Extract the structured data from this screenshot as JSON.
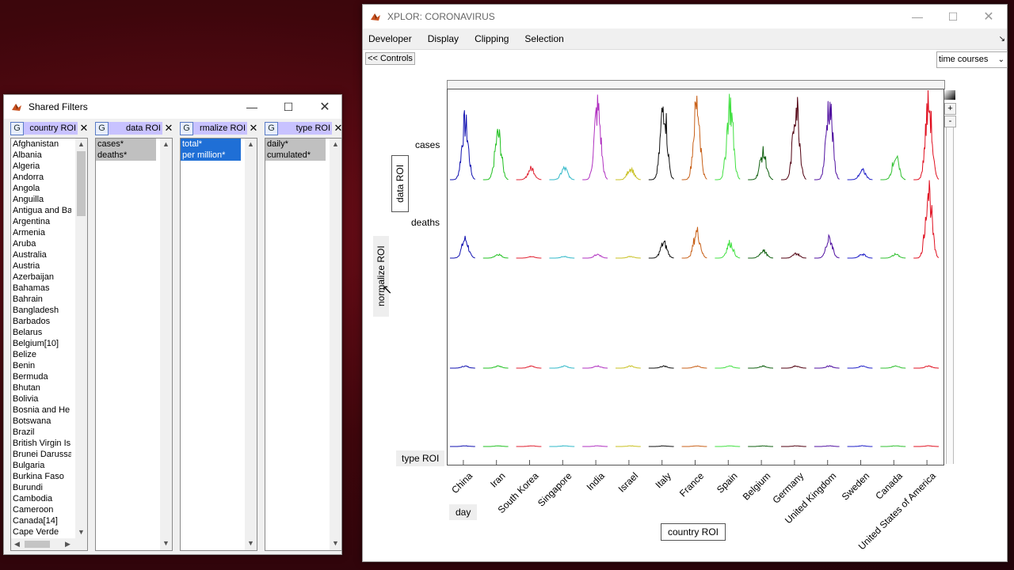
{
  "shared_filters": {
    "title": "Shared Filters",
    "g_label": "G",
    "panels": [
      {
        "title": "country ROI",
        "items": [
          "Afghanistan",
          "Albania",
          "Algeria",
          "Andorra",
          "Angola",
          "Anguilla",
          "Antigua and Ba",
          "Argentina",
          "Armenia",
          "Aruba",
          "Australia",
          "Austria",
          "Azerbaijan",
          "Bahamas",
          "Bahrain",
          "Bangladesh",
          "Barbados",
          "Belarus",
          "Belgium[10]",
          "Belize",
          "Benin",
          "Bermuda",
          "Bhutan",
          "Bolivia",
          "Bosnia and He",
          "Botswana",
          "Brazil",
          "British Virgin Is",
          "Brunei Darussa",
          "Bulgaria",
          "Burkina Faso",
          "Burundi",
          "Cambodia",
          "Cameroon",
          "Canada[14]",
          "Cape Verde"
        ]
      },
      {
        "title": "data ROI",
        "items": [
          "cases*",
          "deaths*"
        ]
      },
      {
        "title": "rmalize ROI",
        "items": [
          "total*",
          "per million*"
        ]
      },
      {
        "title": "type ROI",
        "items": [
          "daily*",
          "cumulated*"
        ]
      }
    ]
  },
  "main": {
    "title": "XPLOR: CORONAVIRUS",
    "menu": [
      "Developer",
      "Display",
      "Clipping",
      "Selection"
    ],
    "controls_button": "<< Controls",
    "view_select": "time courses",
    "zoom_plus": "+",
    "zoom_minus": "-",
    "labels": {
      "data_roi": "data ROI",
      "normalize": "normalize ROI",
      "type_roi": "type ROI",
      "day": "day",
      "country_roi": "country ROI",
      "cases": "cases",
      "deaths": "deaths"
    },
    "countries": [
      "China",
      "Iran",
      "South Korea",
      "Singapore",
      "India",
      "Israel",
      "Italy",
      "France",
      "Spain",
      "Belgium",
      "Germany",
      "United Kingdom",
      "Sweden",
      "Canada",
      "United States of America"
    ],
    "colors": [
      "#1010b0",
      "#20c020",
      "#e02030",
      "#30b8c8",
      "#b030c0",
      "#c8c020",
      "#101010",
      "#c86018",
      "#40e040",
      "#106010",
      "#500010",
      "#5010a0",
      "#2020c8",
      "#30c030",
      "#e01020"
    ]
  }
}
